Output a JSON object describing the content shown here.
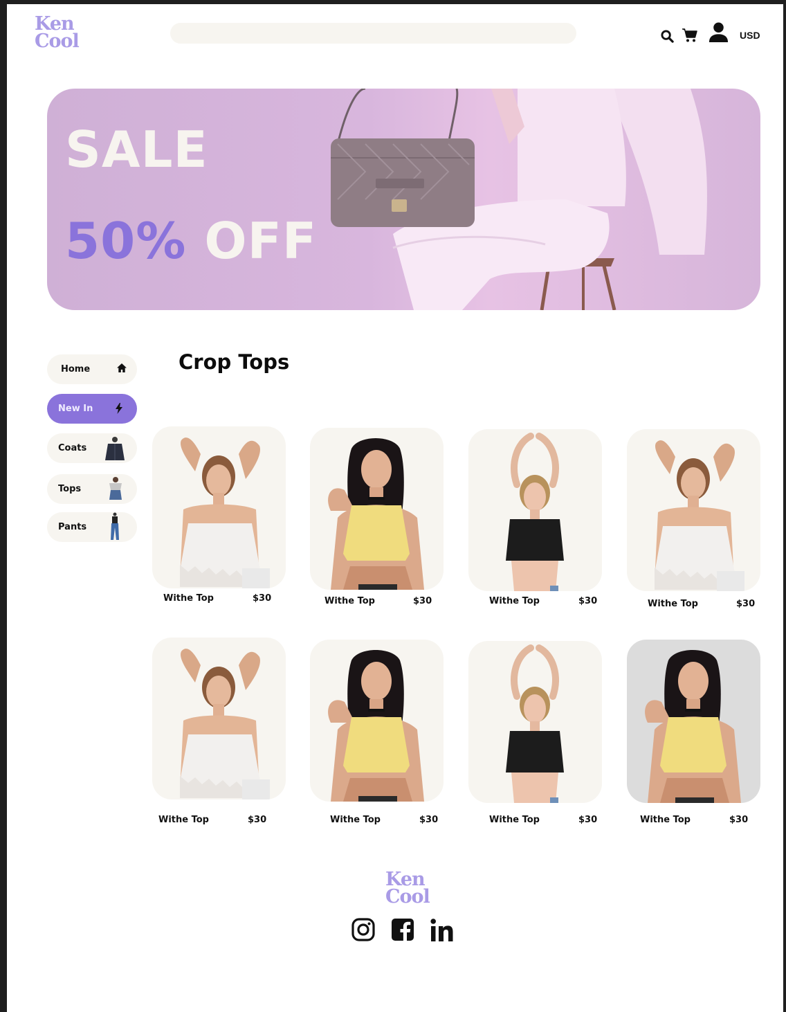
{
  "header": {
    "logo_line1": "Ken",
    "logo_line2": "Cool",
    "search_placeholder": "",
    "currency": "USD",
    "icons": [
      "search-icon",
      "cart-icon",
      "user-icon"
    ]
  },
  "banner": {
    "line1": "SALE",
    "line2_highlight": "50%",
    "line2_rest": "OFF",
    "colors": {
      "text": "#f7f4ef",
      "highlight": "#8a73db",
      "background": "#d4b3da"
    }
  },
  "sidebar": {
    "items": [
      {
        "label": "Home",
        "icon": "home-icon",
        "active": false
      },
      {
        "label": "New In",
        "icon": "bolt-icon",
        "active": true
      },
      {
        "label": "Coats",
        "icon": "coat-thumbnail",
        "active": false
      },
      {
        "label": "Tops",
        "icon": "top-thumbnail",
        "active": false
      },
      {
        "label": "Pants",
        "icon": "pants-thumbnail",
        "active": false
      }
    ]
  },
  "main": {
    "title": "Crop Tops",
    "products": [
      {
        "name": "Withe Top",
        "price": "$30",
        "model": "white-lace-top"
      },
      {
        "name": "Withe Top",
        "price": "$30",
        "model": "yellow-top"
      },
      {
        "name": "Withe Top",
        "price": "$30",
        "model": "black-top"
      },
      {
        "name": "Withe Top",
        "price": "$30",
        "model": "white-lace-top"
      },
      {
        "name": "Withe Top",
        "price": "$30",
        "model": "white-lace-top"
      },
      {
        "name": "Withe Top",
        "price": "$30",
        "model": "yellow-top"
      },
      {
        "name": "Withe Top",
        "price": "$30",
        "model": "black-top"
      },
      {
        "name": "Withe Top",
        "price": "$30",
        "model": "yellow-top"
      }
    ]
  },
  "footer": {
    "logo_line1": "Ken",
    "logo_line2": "Cool",
    "social": [
      "instagram-icon",
      "facebook-icon",
      "linkedin-icon"
    ]
  },
  "colors": {
    "accent": "#8a73db",
    "logo": "#a99be6",
    "card_background": "#f7f5f0"
  }
}
